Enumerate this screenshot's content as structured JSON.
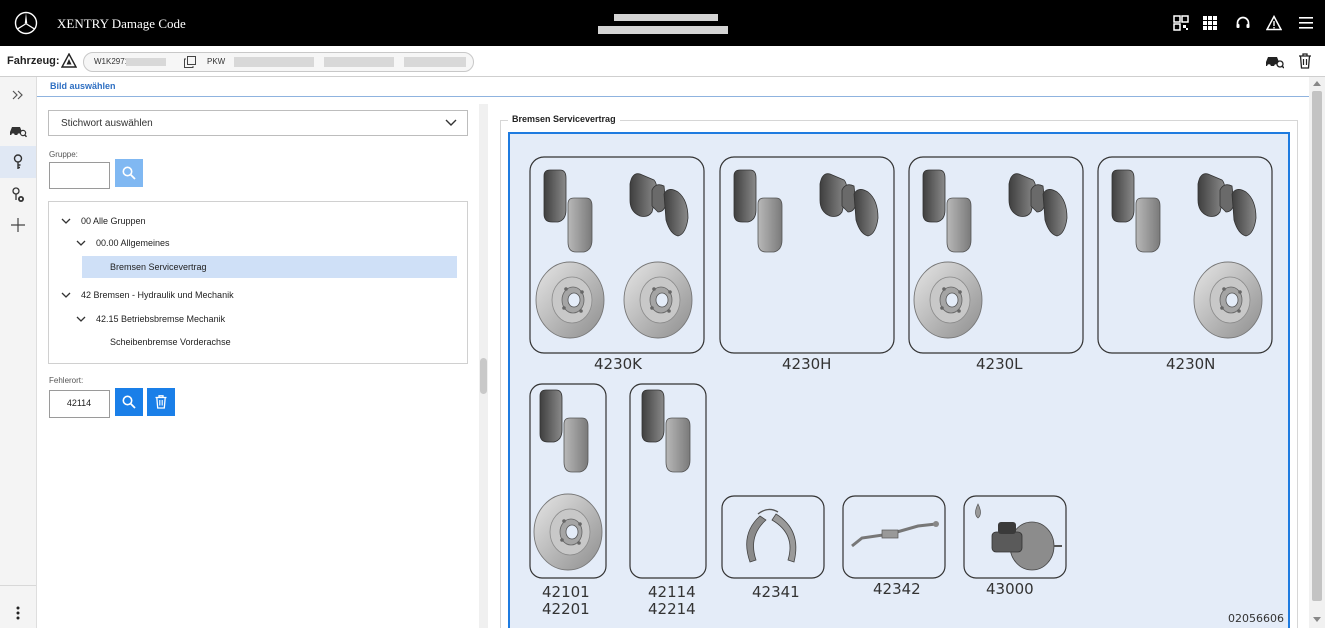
{
  "app": {
    "title": "XENTRY Damage Code"
  },
  "vehicle": {
    "label": "Fahrzeug:",
    "vin": "W1K29714",
    "type": "PKW"
  },
  "section": {
    "title": "Bild auswählen"
  },
  "keyword_select": {
    "value": "Stichwort auswählen"
  },
  "group_field": {
    "label": "Gruppe:",
    "value": ""
  },
  "tree": {
    "items": [
      {
        "label": "00 Alle Gruppen",
        "expanded": true,
        "level": 0
      },
      {
        "label": "00.00 Allgemeines",
        "expanded": true,
        "level": 1
      },
      {
        "label": "Bremsen Servicevertrag",
        "selected": true,
        "level": 2
      },
      {
        "label": "42 Bremsen - Hydraulik und Mechanik",
        "expanded": true,
        "level": 0
      },
      {
        "label": "42.15 Betriebsbremse Mechanik",
        "expanded": true,
        "level": 1
      },
      {
        "label": "Scheibenbremse Vorderachse",
        "level": 2
      }
    ]
  },
  "fehlerort": {
    "label": "Fehlerort:",
    "value": "42114"
  },
  "group_panel": {
    "title": "Bremsen Servicevertrag"
  },
  "diagram": {
    "image_id": "02056606",
    "parts": [
      {
        "code": "4230K"
      },
      {
        "code": "4230H"
      },
      {
        "code": "4230L"
      },
      {
        "code": "4230N"
      },
      {
        "code": "42101",
        "code2": "42201"
      },
      {
        "code": "42114",
        "code2": "42214"
      },
      {
        "code": "42341"
      },
      {
        "code": "42342"
      },
      {
        "code": "43000"
      }
    ]
  },
  "icons": {
    "logo": "mercedes-star-icon",
    "top_right": [
      "qr-scan-icon",
      "apps-grid-icon",
      "headset-icon",
      "warning-icon",
      "menu-icon"
    ],
    "rail": [
      "expand-icon",
      "car-search-icon",
      "key-icon",
      "key-settings-icon",
      "add-icon",
      "more-vertical-icon"
    ]
  },
  "colors": {
    "accent": "#1a7fe8",
    "diagram_bg": "#e4ecf8",
    "selection": "#cfe0f7",
    "topbar": "#000000"
  }
}
